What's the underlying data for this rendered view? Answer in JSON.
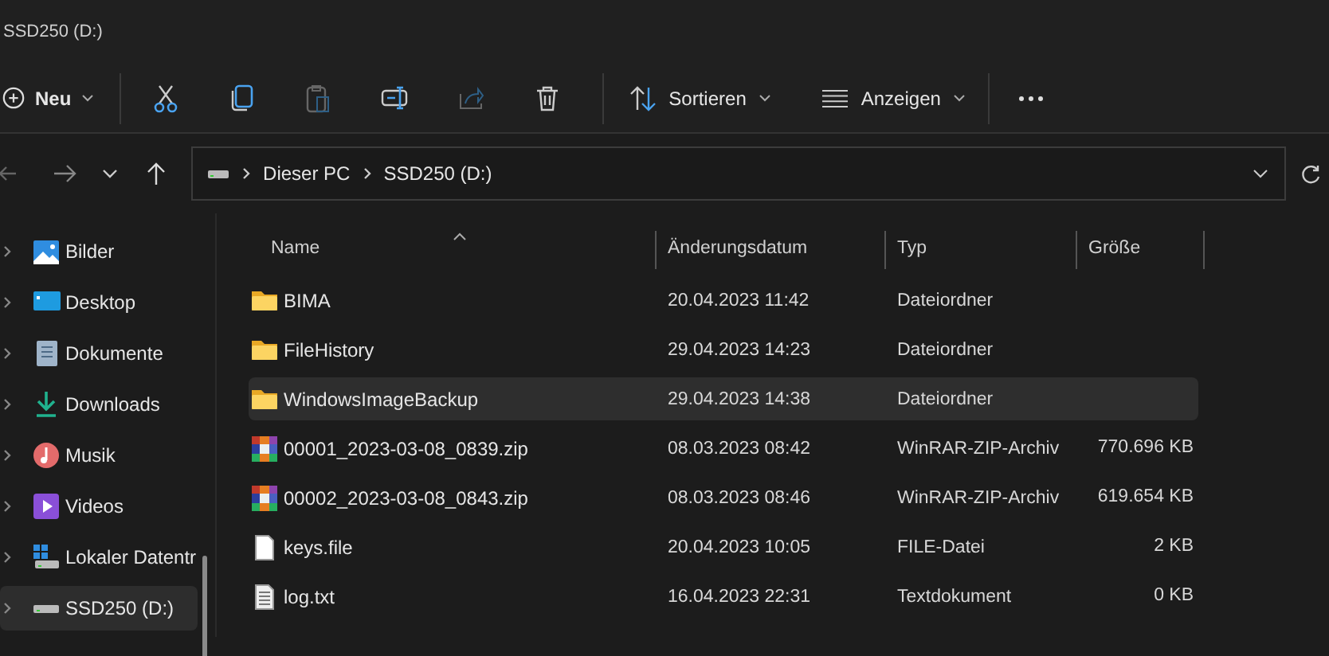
{
  "window": {
    "title": "SSD250 (D:)"
  },
  "toolbar": {
    "new": "Neu",
    "sort": "Sortieren",
    "view": "Anzeigen"
  },
  "address": {
    "crumbs": [
      "Dieser PC",
      "SSD250 (D:)"
    ]
  },
  "sidebar": {
    "items": [
      {
        "label": "Bilder",
        "kind": "pictures",
        "selected": false
      },
      {
        "label": "Desktop",
        "kind": "desktop",
        "selected": false
      },
      {
        "label": "Dokumente",
        "kind": "documents",
        "selected": false
      },
      {
        "label": "Downloads",
        "kind": "downloads",
        "selected": false
      },
      {
        "label": "Musik",
        "kind": "music",
        "selected": false
      },
      {
        "label": "Videos",
        "kind": "videos",
        "selected": false
      },
      {
        "label": "Lokaler Datentr",
        "kind": "system",
        "selected": false
      },
      {
        "label": "SSD250 (D:)",
        "kind": "drive",
        "selected": true
      }
    ]
  },
  "table": {
    "columns": [
      "Name",
      "Änderungsdatum",
      "Typ",
      "Größe"
    ],
    "rows": [
      {
        "name": "BIMA",
        "date": "20.04.2023 11:42",
        "type": "Dateiordner",
        "kind": "folder",
        "selected": false
      },
      {
        "name": "FileHistory",
        "date": "29.04.2023 14:23",
        "type": "Dateiordner",
        "kind": "folder",
        "selected": false
      },
      {
        "name": "WindowsImageBackup",
        "date": "29.04.2023 14:38",
        "type": "Dateiordner",
        "kind": "folder",
        "selected": true
      },
      {
        "name": "00001_2023-03-08_0839.zip",
        "date": "08.03.2023 08:42",
        "type": "WinRAR-ZIP-Archiv",
        "size": "770.696 KB",
        "kind": "archive",
        "selected": false
      },
      {
        "name": "00002_2023-03-08_0843.zip",
        "date": "08.03.2023 08:46",
        "type": "WinRAR-ZIP-Archiv",
        "size": "619.654 KB",
        "kind": "archive",
        "selected": false
      },
      {
        "name": "keys.file",
        "date": "20.04.2023 10:05",
        "type": "FILE-Datei",
        "size": "2 KB",
        "kind": "file",
        "selected": false
      },
      {
        "name": "log.txt",
        "date": "16.04.2023 22:31",
        "type": "Textdokument",
        "size": "0 KB",
        "kind": "text",
        "selected": false
      }
    ]
  }
}
